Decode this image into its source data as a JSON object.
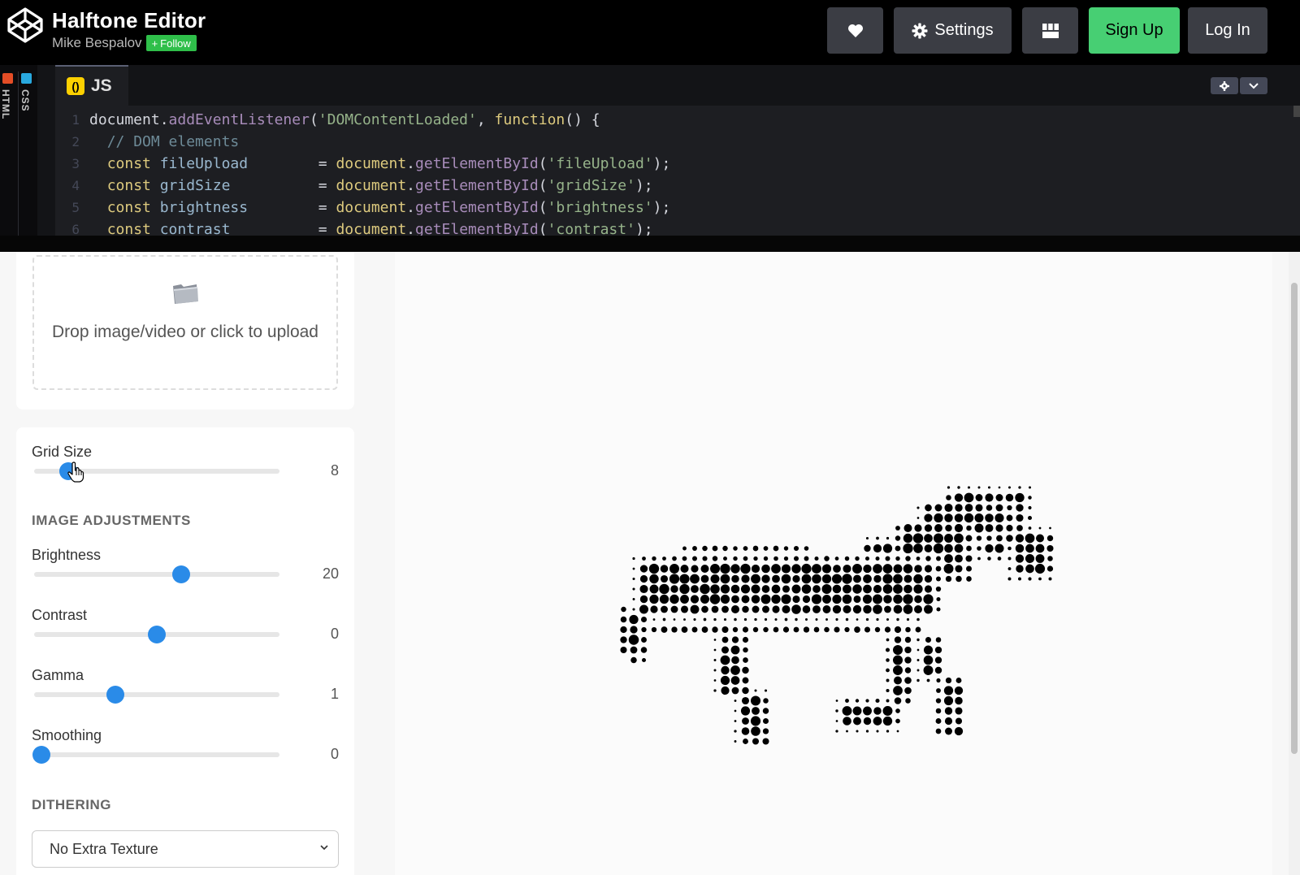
{
  "header": {
    "title": "Halftone Editor",
    "author": "Mike Bespalov",
    "follow_label": "Follow",
    "settings_label": "Settings",
    "signup_label": "Sign Up",
    "login_label": "Log In"
  },
  "editor": {
    "html_tab": "HTML",
    "css_tab": "CSS",
    "js_tab": "JS",
    "lines": [
      {
        "n": "1",
        "parts": [
          [
            "plain",
            "document."
          ],
          [
            "fn",
            "addEventListener"
          ],
          [
            "plain",
            "("
          ],
          [
            "str",
            "'DOMContentLoaded'"
          ],
          [
            "plain",
            ", "
          ],
          [
            "kw",
            "function"
          ],
          [
            "plain",
            "() {"
          ]
        ]
      },
      {
        "n": "2",
        "parts": [
          [
            "plain",
            "  "
          ],
          [
            "cm",
            "// DOM elements"
          ]
        ]
      },
      {
        "n": "3",
        "parts": [
          [
            "plain",
            "  "
          ],
          [
            "kw",
            "const"
          ],
          [
            "plain",
            " "
          ],
          [
            "var",
            "fileUpload"
          ],
          [
            "plain",
            "        = "
          ],
          [
            "kw",
            "document"
          ],
          [
            "plain",
            "."
          ],
          [
            "fn",
            "getElementById"
          ],
          [
            "plain",
            "("
          ],
          [
            "str",
            "'fileUpload'"
          ],
          [
            "plain",
            ");"
          ]
        ]
      },
      {
        "n": "4",
        "parts": [
          [
            "plain",
            "  "
          ],
          [
            "kw",
            "const"
          ],
          [
            "plain",
            " "
          ],
          [
            "var",
            "gridSize"
          ],
          [
            "plain",
            "          = "
          ],
          [
            "kw",
            "document"
          ],
          [
            "plain",
            "."
          ],
          [
            "fn",
            "getElementById"
          ],
          [
            "plain",
            "("
          ],
          [
            "str",
            "'gridSize'"
          ],
          [
            "plain",
            ");"
          ]
        ]
      },
      {
        "n": "5",
        "parts": [
          [
            "plain",
            "  "
          ],
          [
            "kw",
            "const"
          ],
          [
            "plain",
            " "
          ],
          [
            "var",
            "brightness"
          ],
          [
            "plain",
            "        = "
          ],
          [
            "kw",
            "document"
          ],
          [
            "plain",
            "."
          ],
          [
            "fn",
            "getElementById"
          ],
          [
            "plain",
            "("
          ],
          [
            "str",
            "'brightness'"
          ],
          [
            "plain",
            ");"
          ]
        ]
      },
      {
        "n": "6",
        "parts": [
          [
            "plain",
            "  "
          ],
          [
            "kw",
            "const"
          ],
          [
            "plain",
            " "
          ],
          [
            "var",
            "contrast"
          ],
          [
            "plain",
            "          = "
          ],
          [
            "kw",
            "document"
          ],
          [
            "plain",
            "."
          ],
          [
            "fn",
            "getElementById"
          ],
          [
            "plain",
            "("
          ],
          [
            "str",
            "'contrast'"
          ],
          [
            "plain",
            ");"
          ]
        ]
      }
    ]
  },
  "upload": {
    "text": "Drop image/video or click to upload"
  },
  "controls": {
    "grid_size": {
      "label": "Grid Size",
      "value": "8",
      "fraction": 0.14
    },
    "image_adjustments_heading": "IMAGE ADJUSTMENTS",
    "brightness": {
      "label": "Brightness",
      "value": "20",
      "fraction": 0.6
    },
    "contrast": {
      "label": "Contrast",
      "value": "0",
      "fraction": 0.5
    },
    "gamma": {
      "label": "Gamma",
      "value": "1",
      "fraction": 0.33
    },
    "smoothing": {
      "label": "Smoothing",
      "value": "0",
      "fraction": 0.03
    },
    "dithering_heading": "DITHERING",
    "dithering_select": "No Extra Texture"
  },
  "colors": {
    "accent": "#2a8be8",
    "signup": "#47cf73",
    "follow": "#2fbf4a",
    "js_icon": "#fcd000"
  }
}
